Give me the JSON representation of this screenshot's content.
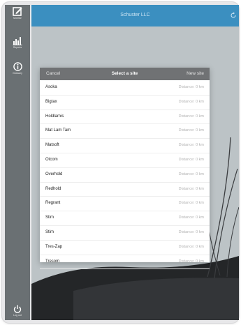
{
  "app": {
    "title": "Schuster LLC"
  },
  "sidebar": {
    "items": [
      {
        "label": "Monitor",
        "icon": "edit-icon"
      },
      {
        "label": "Reports",
        "icon": "bar-chart-icon"
      },
      {
        "label": "Glossary",
        "icon": "info-icon"
      }
    ],
    "logout_label": "Log out"
  },
  "modal": {
    "cancel_label": "Cancel",
    "title": "Select a site",
    "new_site_label": "New site",
    "sites": [
      {
        "name": "Asoka",
        "distance": "Distance: 0 km"
      },
      {
        "name": "Bigtax",
        "distance": "Distance: 0 km"
      },
      {
        "name": "Holdlamis",
        "distance": "Distance: 0 km"
      },
      {
        "name": "Mat Lam Tam",
        "distance": "Distance: 0 km"
      },
      {
        "name": "Matsoft",
        "distance": "Distance: 0 km"
      },
      {
        "name": "Otcom",
        "distance": "Distance: 0 km"
      },
      {
        "name": "Overhold",
        "distance": "Distance: 0 km"
      },
      {
        "name": "Redhold",
        "distance": "Distance: 0 km"
      },
      {
        "name": "Regrant",
        "distance": "Distance: 0 km"
      },
      {
        "name": "Stim",
        "distance": "Distance: 0 km"
      },
      {
        "name": "Stim",
        "distance": "Distance: 0 km"
      },
      {
        "name": "Tres-Zap",
        "distance": "Distance: 0 km"
      },
      {
        "name": "Tresom",
        "distance": "Distance: 0 km"
      }
    ]
  },
  "colors": {
    "topbar": "#3b8fc0",
    "sidebar": "#6a7073",
    "modal_header": "#707274"
  }
}
